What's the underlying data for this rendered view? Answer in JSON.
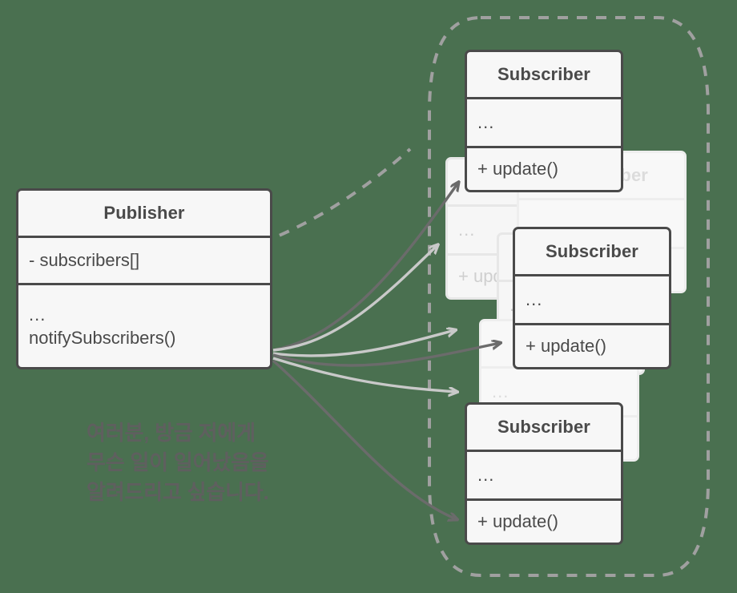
{
  "diagram": {
    "type": "uml-class-diagram",
    "pattern": "Observer / Publisher-Subscriber",
    "background_color": "#4a7050",
    "box_fill": "#f7f7f7",
    "box_stroke": "#4a4a4a",
    "ghost_stroke": "#e7e7e7",
    "arrow_dark": "#6b6b6b",
    "arrow_light": "#c9c9c9",
    "dashed_stroke": "#a0a0a0",
    "text_color": "#4a4a4a",
    "speech_color": "#5f5f5f"
  },
  "publisher": {
    "title": "Publisher",
    "attribute": "- subscribers[]",
    "operations_dots": "...",
    "operation": "notifySubscribers()"
  },
  "subscriber": {
    "title": "Subscriber",
    "attributes_dots": "...",
    "operation": "+ update()"
  },
  "subscribers": [
    {
      "title": "Subscriber",
      "attributes_dots": "...",
      "operation": "+ update()"
    },
    {
      "title": "Subscriber",
      "attributes_dots": "...",
      "operation": "+ update()"
    },
    {
      "title": "Subscriber",
      "attributes_dots": "...",
      "operation": "+ update()"
    }
  ],
  "ghost_subscribers": [
    {
      "title": "Subscriber",
      "attributes_dots": "...",
      "operation": "+ update()"
    },
    {
      "title": "Subscriber",
      "attributes_dots": "...",
      "operation": "+ update()"
    },
    {
      "title": "Subscriber",
      "attributes_dots": "...",
      "operation": "+ update()"
    },
    {
      "title": "Subscriber",
      "attributes_dots": "...",
      "operation": "+ update()"
    }
  ],
  "speech": {
    "line1": "여러분, 방금 저에게",
    "line2": "무슨 일이 일어났음을",
    "line3": "알려드리고 싶습니다."
  }
}
